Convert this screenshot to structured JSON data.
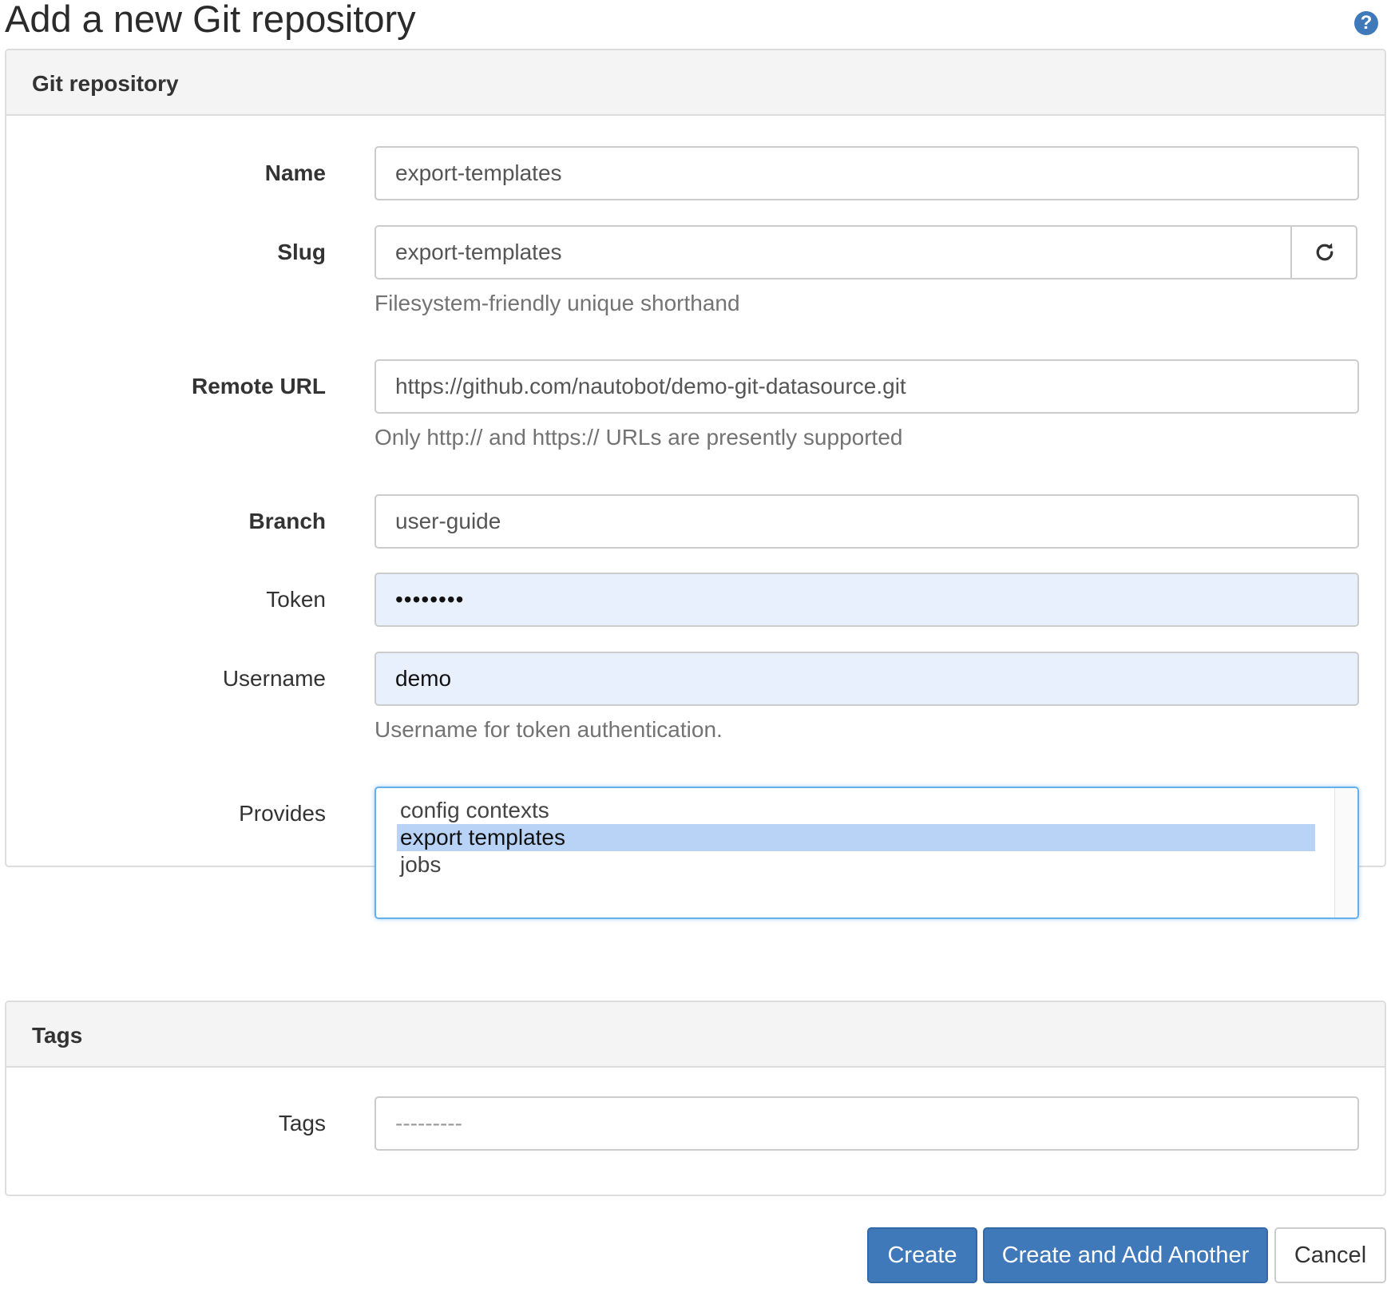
{
  "page": {
    "title": "Add a new Git repository",
    "help_icon": "question-circle-icon",
    "help_glyph": "?"
  },
  "git_panel": {
    "heading": "Git repository",
    "fields": {
      "name": {
        "label": "Name",
        "value": "export-templates"
      },
      "slug": {
        "label": "Slug",
        "value": "export-templates",
        "help": "Filesystem-friendly unique shorthand",
        "regenerate_icon": "refresh-icon"
      },
      "remote_url": {
        "label": "Remote URL",
        "value": "https://github.com/nautobot/demo-git-datasource.git",
        "help": "Only http:// and https:// URLs are presently supported"
      },
      "branch": {
        "label": "Branch",
        "value": "user-guide"
      },
      "token": {
        "label": "Token",
        "value": "••••••••"
      },
      "username": {
        "label": "Username",
        "value": "demo",
        "help": "Username for token authentication."
      },
      "provides": {
        "label": "Provides",
        "options": [
          "config contexts",
          "export templates",
          "jobs"
        ],
        "selected": "export templates"
      }
    }
  },
  "tags_panel": {
    "heading": "Tags",
    "tags": {
      "label": "Tags",
      "placeholder": "---------"
    }
  },
  "actions": {
    "create": "Create",
    "create_and_add_another": "Create and Add Another",
    "cancel": "Cancel"
  },
  "colors": {
    "primary": "#3f79ba",
    "autofill": "#e8f0fe",
    "selected_option": "#b8d3f6",
    "panel_heading": "#f4f4f4"
  }
}
